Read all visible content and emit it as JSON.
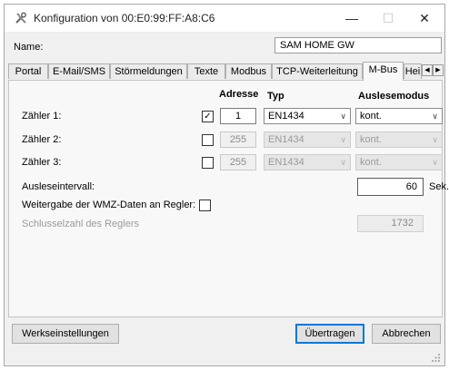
{
  "window": {
    "title": "Konfiguration von 00:E0:99:FF:A8:C6",
    "minimize_glyph": "—",
    "maximize_glyph": "☐",
    "close_glyph": "✕",
    "app_icon": "tools-icon"
  },
  "name_field": {
    "label": "Name:",
    "value": "SAM HOME GW"
  },
  "tabs": [
    {
      "label": "Portal"
    },
    {
      "label": "E-Mail/SMS"
    },
    {
      "label": "Störmeldungen"
    },
    {
      "label": "Texte"
    },
    {
      "label": "Modbus"
    },
    {
      "label": "TCP-Weiterleitung"
    },
    {
      "label": "M-Bus",
      "active": true
    },
    {
      "label": "Hei"
    }
  ],
  "tab_scroll": {
    "left": "◀",
    "right": "▶"
  },
  "mbus": {
    "headers": {
      "address": "Adresse",
      "type": "Typ",
      "mode": "Auslesemodus"
    },
    "meters": [
      {
        "label": "Zähler 1:",
        "checked": true,
        "check_glyph": "✓",
        "address": "1",
        "type": "EN1434",
        "mode": "kont."
      },
      {
        "label": "Zähler 2:",
        "checked": false,
        "check_glyph": "",
        "address": "255",
        "type": "EN1434",
        "mode": "kont."
      },
      {
        "label": "Zähler 3:",
        "checked": false,
        "check_glyph": "",
        "address": "255",
        "type": "EN1434",
        "mode": "kont."
      }
    ],
    "dropdown_arrow": "∨",
    "interval": {
      "label": "Ausleseintervall:",
      "value": "60",
      "unit": "Sek."
    },
    "forward": {
      "label": "Weitergabe der WMZ-Daten an Regler:"
    },
    "key": {
      "label": "Schlusselzahl des Reglers",
      "value": "1732"
    }
  },
  "buttons": {
    "defaults": "Werkseinstellungen",
    "transfer": "Übertragen",
    "cancel": "Abbrechen"
  },
  "colors": {
    "accent": "#0078d7"
  }
}
